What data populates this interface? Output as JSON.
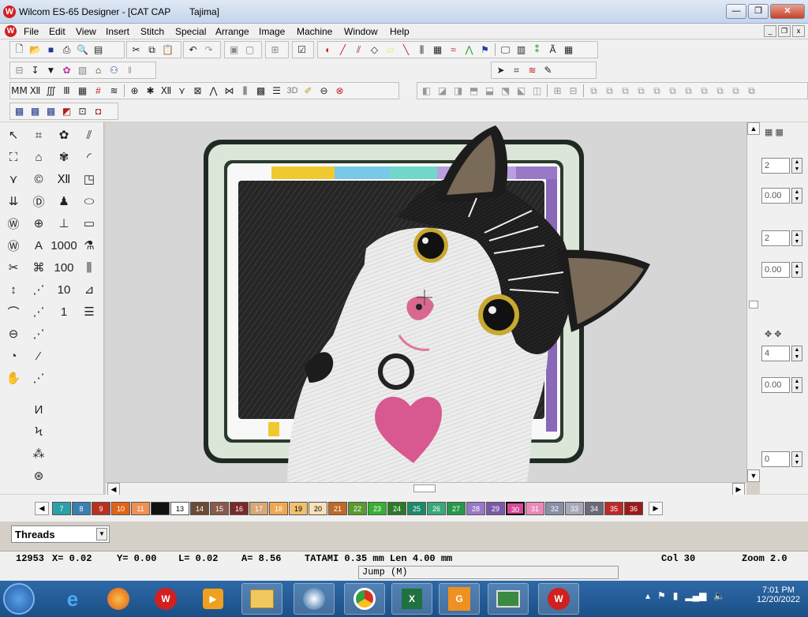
{
  "window": {
    "app_title": "Wilcom ES-65 Designer - [CAT CAP",
    "doc_suffix": "Tajima]"
  },
  "menu": [
    "File",
    "Edit",
    "View",
    "Insert",
    "Stitch",
    "Special",
    "Arrange",
    "Image",
    "Machine",
    "Window",
    "Help"
  ],
  "right_panel": {
    "spin1": "2",
    "spin2": "0.00",
    "spin3": "2",
    "spin4": "0.00",
    "spin5": "4",
    "spin6": "0.00",
    "spin7": "0"
  },
  "color_chips": [
    {
      "n": "7",
      "c": "#2aa0a8"
    },
    {
      "n": "8",
      "c": "#3a7fb0"
    },
    {
      "n": "9",
      "c": "#b83020"
    },
    {
      "n": "10",
      "c": "#e06418"
    },
    {
      "n": "11",
      "c": "#f09050"
    },
    {
      "n": "",
      "c": "#111111"
    },
    {
      "n": "13",
      "c": "#ffffff"
    },
    {
      "n": "14",
      "c": "#6a4a38"
    },
    {
      "n": "15",
      "c": "#8a5a48"
    },
    {
      "n": "16",
      "c": "#7a2a28"
    },
    {
      "n": "17",
      "c": "#d8a878"
    },
    {
      "n": "18",
      "c": "#f0a850"
    },
    {
      "n": "19",
      "c": "#f0c070"
    },
    {
      "n": "20",
      "c": "#f8e0b8"
    },
    {
      "n": "21",
      "c": "#c06828"
    },
    {
      "n": "22",
      "c": "#5a9a30"
    },
    {
      "n": "23",
      "c": "#38b030"
    },
    {
      "n": "24",
      "c": "#2a7a28"
    },
    {
      "n": "25",
      "c": "#1a8a68"
    },
    {
      "n": "26",
      "c": "#38a878"
    },
    {
      "n": "27",
      "c": "#289848"
    },
    {
      "n": "28",
      "c": "#9a78c8"
    },
    {
      "n": "29",
      "c": "#7a58a8"
    },
    {
      "n": "30",
      "c": "#d84898"
    },
    {
      "n": "31",
      "c": "#e88ab8"
    },
    {
      "n": "32",
      "c": "#8890a8"
    },
    {
      "n": "33",
      "c": "#a8a8b8"
    },
    {
      "n": "34",
      "c": "#6a6a7a"
    },
    {
      "n": "35",
      "c": "#c02828"
    },
    {
      "n": "36",
      "c": "#a01818"
    }
  ],
  "threads_label": "Threads",
  "status": {
    "stitches": "12953",
    "x": "X=  0.02",
    "y": "Y=  0.00",
    "l": "L=  0.02",
    "a": "A=  8.56",
    "stitch_type": "TATAMI  0.35 mm Len  4.00 mm",
    "col": "Col 30",
    "zoom": "Zoom 2.0"
  },
  "jump": "Jump (M)",
  "tray": {
    "time": "7:01 PM",
    "date": "12/20/2022"
  },
  "colors": {
    "accent": "#d84898",
    "tatami_bg": "#2a2a2a",
    "frame": "#dde8dc",
    "heart": "#d85890"
  }
}
